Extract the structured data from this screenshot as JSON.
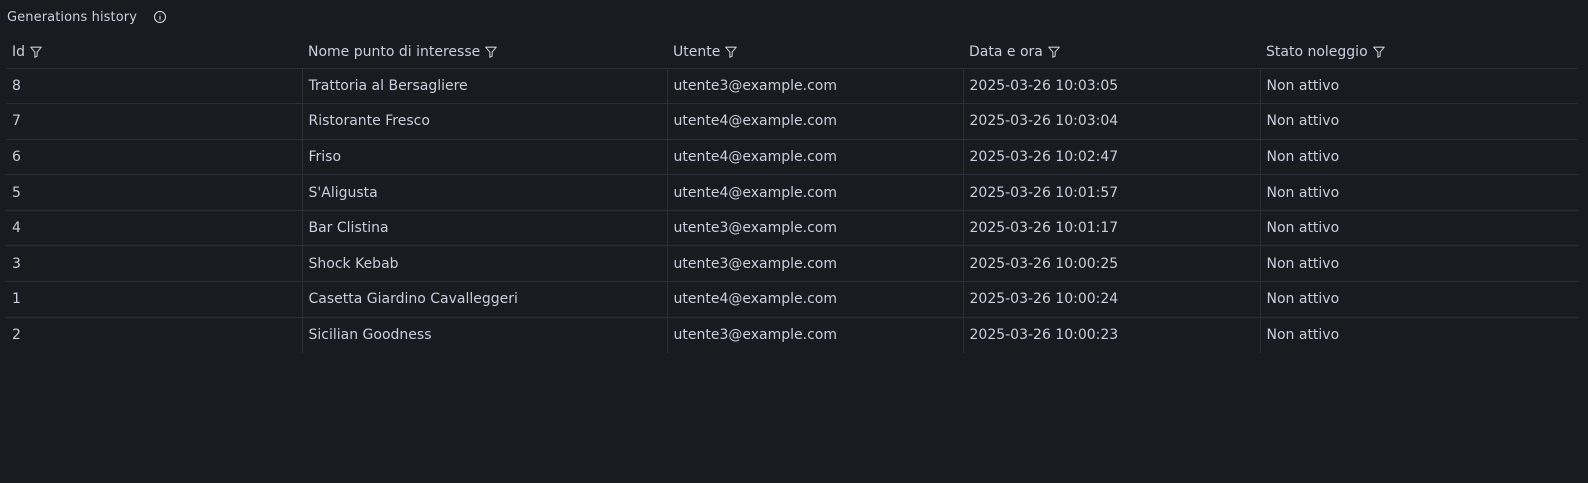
{
  "panel": {
    "title": "Generations history",
    "info_icon": "info-circle-icon"
  },
  "colors": {
    "background": "#181b1f",
    "text": "#ccccdc",
    "link": "#6e9fff",
    "border": "#2c3038"
  },
  "table": {
    "columns": [
      {
        "label": "Id",
        "icon": "filter-icon"
      },
      {
        "label": "Nome punto di interesse",
        "icon": "filter-icon"
      },
      {
        "label": "Utente",
        "icon": "filter-icon"
      },
      {
        "label": "Data e ora",
        "icon": "filter-icon"
      },
      {
        "label": "Stato noleggio",
        "icon": "filter-icon"
      }
    ],
    "rows": [
      {
        "id": "8",
        "poi": "Trattoria al Bersagliere",
        "user": "utente3@example.com",
        "datetime": "2025-03-26 10:03:05",
        "status": "Non attivo"
      },
      {
        "id": "7",
        "poi": "Ristorante Fresco",
        "user": "utente4@example.com",
        "datetime": "2025-03-26 10:03:04",
        "status": "Non attivo"
      },
      {
        "id": "6",
        "poi": "Friso",
        "user": "utente4@example.com",
        "datetime": "2025-03-26 10:02:47",
        "status": "Non attivo"
      },
      {
        "id": "5",
        "poi": "S'Aligusta",
        "user": "utente4@example.com",
        "datetime": "2025-03-26 10:01:57",
        "status": "Non attivo"
      },
      {
        "id": "4",
        "poi": "Bar Clistina",
        "user": "utente3@example.com",
        "datetime": "2025-03-26 10:01:17",
        "status": "Non attivo"
      },
      {
        "id": "3",
        "poi": "Shock Kebab",
        "user": "utente3@example.com",
        "datetime": "2025-03-26 10:00:25",
        "status": "Non attivo"
      },
      {
        "id": "1",
        "poi": "Casetta Giardino Cavalleggeri",
        "user": "utente4@example.com",
        "datetime": "2025-03-26 10:00:24",
        "status": "Non attivo"
      },
      {
        "id": "2",
        "poi": "Sicilian Goodness",
        "user": "utente3@example.com",
        "datetime": "2025-03-26 10:00:23",
        "status": "Non attivo"
      }
    ]
  }
}
